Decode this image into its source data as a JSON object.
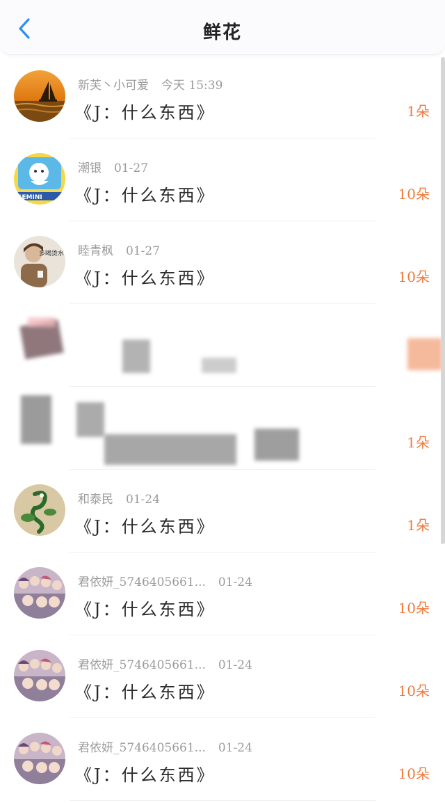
{
  "nav": {
    "title": "鲜花",
    "back_icon": "chevron-left-icon",
    "accent": "#2e8ff0"
  },
  "items": [
    {
      "name": "新芙丶小可爱",
      "date": "今天 15:39",
      "title": "《J：什么东西》",
      "count": "1朵"
    },
    {
      "name": "潮银",
      "date": "01-27",
      "title": "《J：什么东西》",
      "count": "10朵"
    },
    {
      "name": "睦青枫",
      "date": "01-27",
      "title": "《J：什么东西》",
      "count": "10朵"
    },
    {
      "name": "",
      "date": "",
      "title": "",
      "count": ""
    },
    {
      "name": "",
      "date": "",
      "title": "",
      "count": "1朵"
    },
    {
      "name": "和泰民",
      "date": "01-24",
      "title": "《J：什么东西》",
      "count": "1朵"
    },
    {
      "name": "君依妍_5746405661...",
      "date": "01-24",
      "title": "《J：什么东西》",
      "count": "10朵"
    },
    {
      "name": "君依妍_5746405661...",
      "date": "01-24",
      "title": "《J：什么东西》",
      "count": "10朵"
    },
    {
      "name": "君依妍_5746405661...",
      "date": "01-24",
      "title": "《J：什么东西》",
      "count": "10朵"
    }
  ],
  "avatar_text": {
    "item2": "GEMINI",
    "item3": "多喝烫水"
  },
  "colors": {
    "count": "#f07a3c",
    "meta": "#9b9b9b"
  }
}
